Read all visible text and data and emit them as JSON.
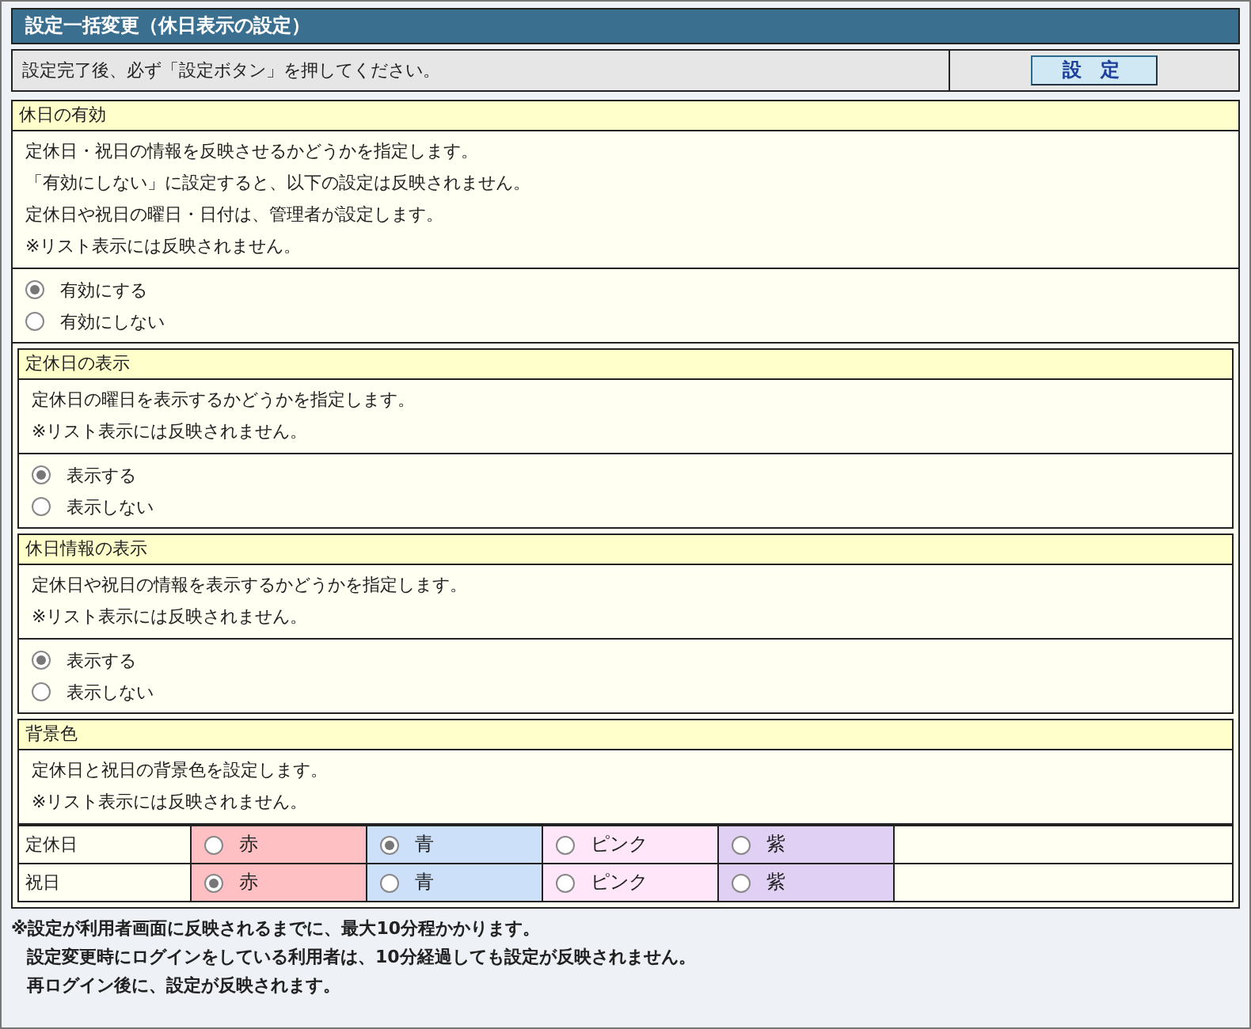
{
  "title": "設定一括変更（休日表示の設定）",
  "notice": {
    "text": "設定完了後、必ず「設定ボタン」を押してください。",
    "button": "設 定"
  },
  "section": {
    "heading": "休日の有効",
    "description": [
      "定休日・祝日の情報を反映させるかどうかを指定します。",
      "「有効にしない」に設定すると、以下の設定は反映されません。",
      "定休日や祝日の曜日・日付は、管理者が設定します。",
      "※リスト表示には反映されません。"
    ],
    "options": [
      {
        "label": "有効にする",
        "selected": true
      },
      {
        "label": "有効にしない",
        "selected": false
      }
    ],
    "subsections": [
      {
        "kind": "radio",
        "heading": "定休日の表示",
        "description": [
          "定休日の曜日を表示するかどうかを指定します。",
          "※リスト表示には反映されません。"
        ],
        "options": [
          {
            "label": "表示する",
            "selected": true
          },
          {
            "label": "表示しない",
            "selected": false
          }
        ]
      },
      {
        "kind": "radio",
        "heading": "休日情報の表示",
        "description": [
          "定休日や祝日の情報を表示するかどうかを指定します。",
          "※リスト表示には反映されません。"
        ],
        "options": [
          {
            "label": "表示する",
            "selected": true
          },
          {
            "label": "表示しない",
            "selected": false
          }
        ]
      },
      {
        "kind": "color",
        "heading": "背景色",
        "description": [
          "定休日と祝日の背景色を設定します。",
          "※リスト表示には反映されません。"
        ],
        "rows": [
          {
            "label": "定休日",
            "options": [
              {
                "label": "赤",
                "color": "#ffc0c4",
                "selected": false
              },
              {
                "label": "青",
                "color": "#cce0fa",
                "selected": true
              },
              {
                "label": "ピンク",
                "color": "#ffe6f8",
                "selected": false
              },
              {
                "label": "紫",
                "color": "#e0d0f4",
                "selected": false
              }
            ]
          },
          {
            "label": "祝日",
            "options": [
              {
                "label": "赤",
                "color": "#ffc0c4",
                "selected": true
              },
              {
                "label": "青",
                "color": "#cce0fa",
                "selected": false
              },
              {
                "label": "ピンク",
                "color": "#ffe6f8",
                "selected": false
              },
              {
                "label": "紫",
                "color": "#e0d0f4",
                "selected": false
              }
            ]
          }
        ]
      }
    ]
  },
  "footnotes": [
    "※設定が利用者画面に反映されるまでに、最大10分程かかります。",
    "設定変更時にログインをしている利用者は、10分経過しても設定が反映されません。",
    "再ログイン後に、設定が反映されます。"
  ]
}
